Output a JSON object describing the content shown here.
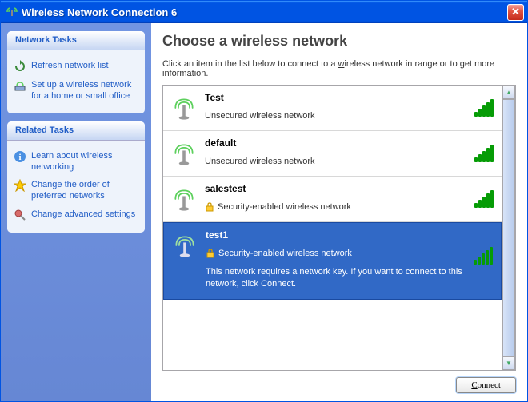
{
  "window": {
    "title": "Wireless Network Connection 6"
  },
  "sidebar": {
    "networkTasks": {
      "header": "Network Tasks",
      "items": [
        {
          "label": "Refresh network list",
          "icon": "refresh-icon"
        },
        {
          "label": "Set up a wireless network for a home or small office",
          "icon": "setup-icon"
        }
      ]
    },
    "relatedTasks": {
      "header": "Related Tasks",
      "items": [
        {
          "label": "Learn about wireless networking",
          "icon": "info-icon"
        },
        {
          "label": "Change the order of preferred networks",
          "icon": "star-icon"
        },
        {
          "label": "Change advanced settings",
          "icon": "settings-icon"
        }
      ]
    }
  },
  "main": {
    "title": "Choose a wireless network",
    "descBefore": "Click an item in the list below to connect to a ",
    "descUnderline": "w",
    "descAfter": "ireless network in range or to get more information.",
    "networks": [
      {
        "name": "Test",
        "status": "Unsecured wireless network",
        "secured": false,
        "signal": 5,
        "selected": false
      },
      {
        "name": "default",
        "status": "Unsecured wireless network",
        "secured": false,
        "signal": 5,
        "selected": false
      },
      {
        "name": "salestest",
        "status": "Security-enabled wireless network",
        "secured": true,
        "signal": 5,
        "selected": false
      },
      {
        "name": "test1",
        "status": "Security-enabled wireless network",
        "secured": true,
        "signal": 5,
        "selected": true,
        "extra": "This network requires a network key. If you want to connect to this network, click Connect."
      }
    ],
    "connectLabel": "Connect"
  },
  "colors": {
    "accent": "#3169c6",
    "link": "#215dc6",
    "signalOn": "#069c06"
  }
}
